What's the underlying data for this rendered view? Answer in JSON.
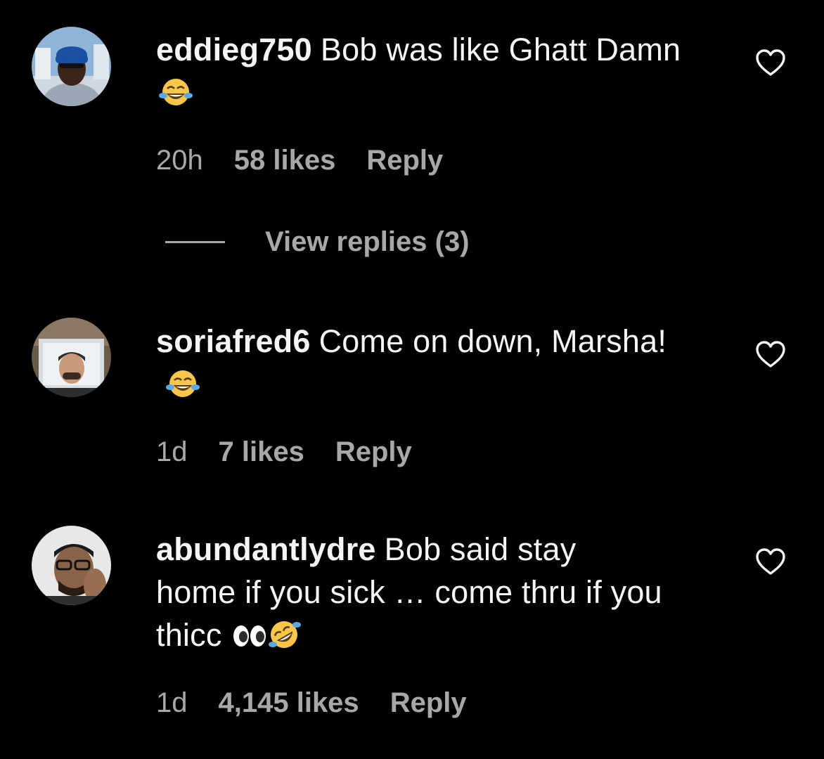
{
  "comments": [
    {
      "username": "eddieg750",
      "text": "Bob was like Ghatt Damn",
      "emojis": [
        "face-with-tears-of-joy"
      ],
      "time": "20h",
      "likes": "58 likes",
      "reply_label": "Reply",
      "liked": false
    },
    {
      "username": "soriafred6",
      "text": "Come on down, Marsha!",
      "emojis": [
        "face-with-tears-of-joy"
      ],
      "time": "1d",
      "likes": "7 likes",
      "reply_label": "Reply",
      "liked": false
    },
    {
      "username": "abundantlydre",
      "text": "Bob said stay home if you sick … come thru if you thicc",
      "emojis": [
        "eyes",
        "rolling-on-the-floor-laughing"
      ],
      "time": "1d",
      "likes": "4,145 likes",
      "reply_label": "Reply",
      "liked": false
    }
  ],
  "view_replies": {
    "label": "View replies (3)"
  },
  "colors": {
    "background": "#000000",
    "primary_text": "#f5f5f5",
    "secondary_text": "#a8a8a8"
  }
}
